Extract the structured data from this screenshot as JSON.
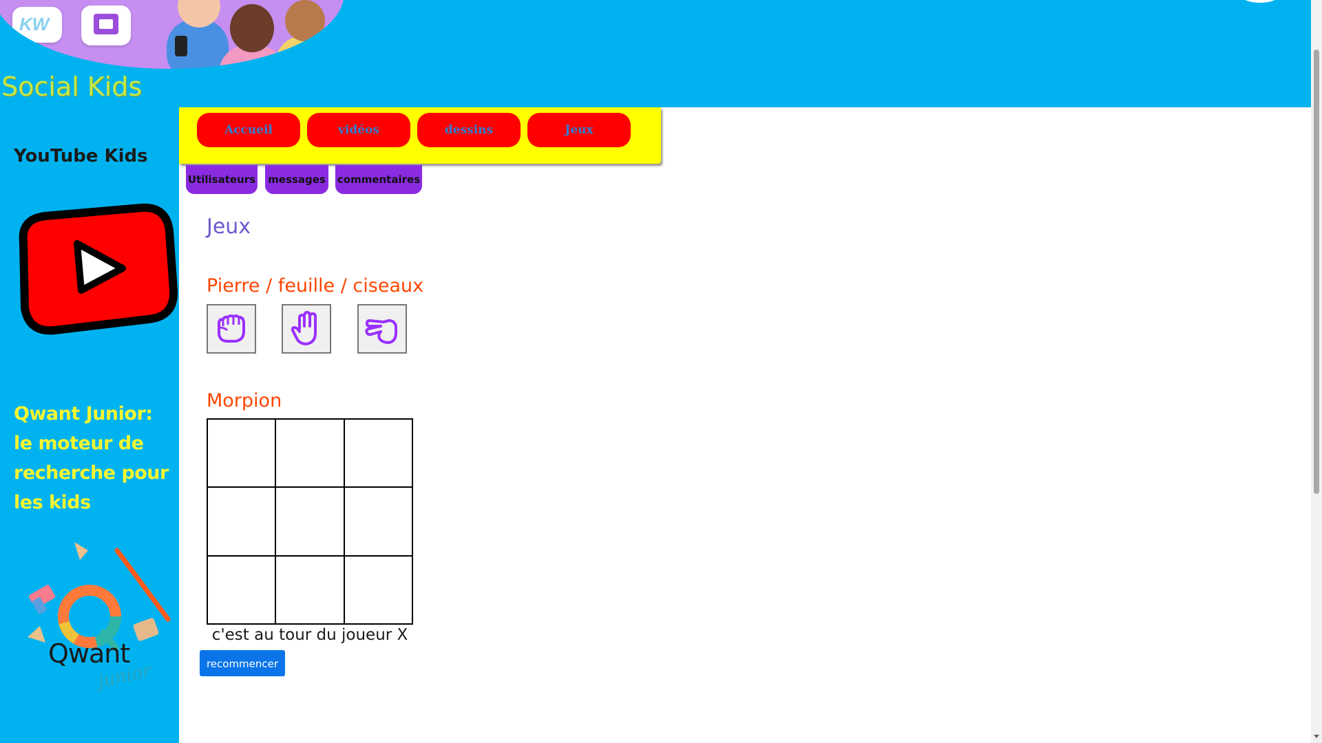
{
  "header": {
    "site_title": "Social Kids",
    "colors": {
      "background": "#00b3f0",
      "title": "#c5e84a",
      "hero": "#c58ef0"
    },
    "app_tile_label": "KW"
  },
  "sidebar": {
    "youtube": {
      "title": "YouTube Kids",
      "logo_icon": "youtube-play-icon"
    },
    "qwant": {
      "title": "Qwant Junior: le moteur de recherche pour les kids",
      "logo_word": "Qwant",
      "logo_sub": "junior"
    },
    "colors": {
      "background": "#00b3f0",
      "qwant_title": "#f5f532"
    }
  },
  "nav": {
    "items": [
      {
        "label": "Accueil"
      },
      {
        "label": "vidéos"
      },
      {
        "label": "dessins"
      },
      {
        "label": "Jeux"
      }
    ],
    "colors": {
      "bar": "#ffff00",
      "button": "#ff0000",
      "button_text": "#2b7fd6"
    }
  },
  "subnav": {
    "items": [
      {
        "label": "Utilisateurs"
      },
      {
        "label": "messages"
      },
      {
        "label": "commentaires"
      }
    ],
    "color": "#8a2be2"
  },
  "main": {
    "page_title": "Jeux",
    "rps": {
      "title": "Pierre / feuille / ciseaux",
      "choices": [
        {
          "icon": "rock-fist-icon"
        },
        {
          "icon": "paper-hand-icon"
        },
        {
          "icon": "scissors-hand-icon"
        }
      ],
      "icon_color": "#9b30ff"
    },
    "morpion": {
      "title": "Morpion",
      "cells": [
        "",
        "",
        "",
        "",
        "",
        "",
        "",
        "",
        ""
      ],
      "status": "c'est au tour du joueur X",
      "restart_label": "recommencer"
    },
    "colors": {
      "page_title": "#6a5acd",
      "section_title": "#ff4500",
      "restart": "#0a74e8"
    }
  }
}
